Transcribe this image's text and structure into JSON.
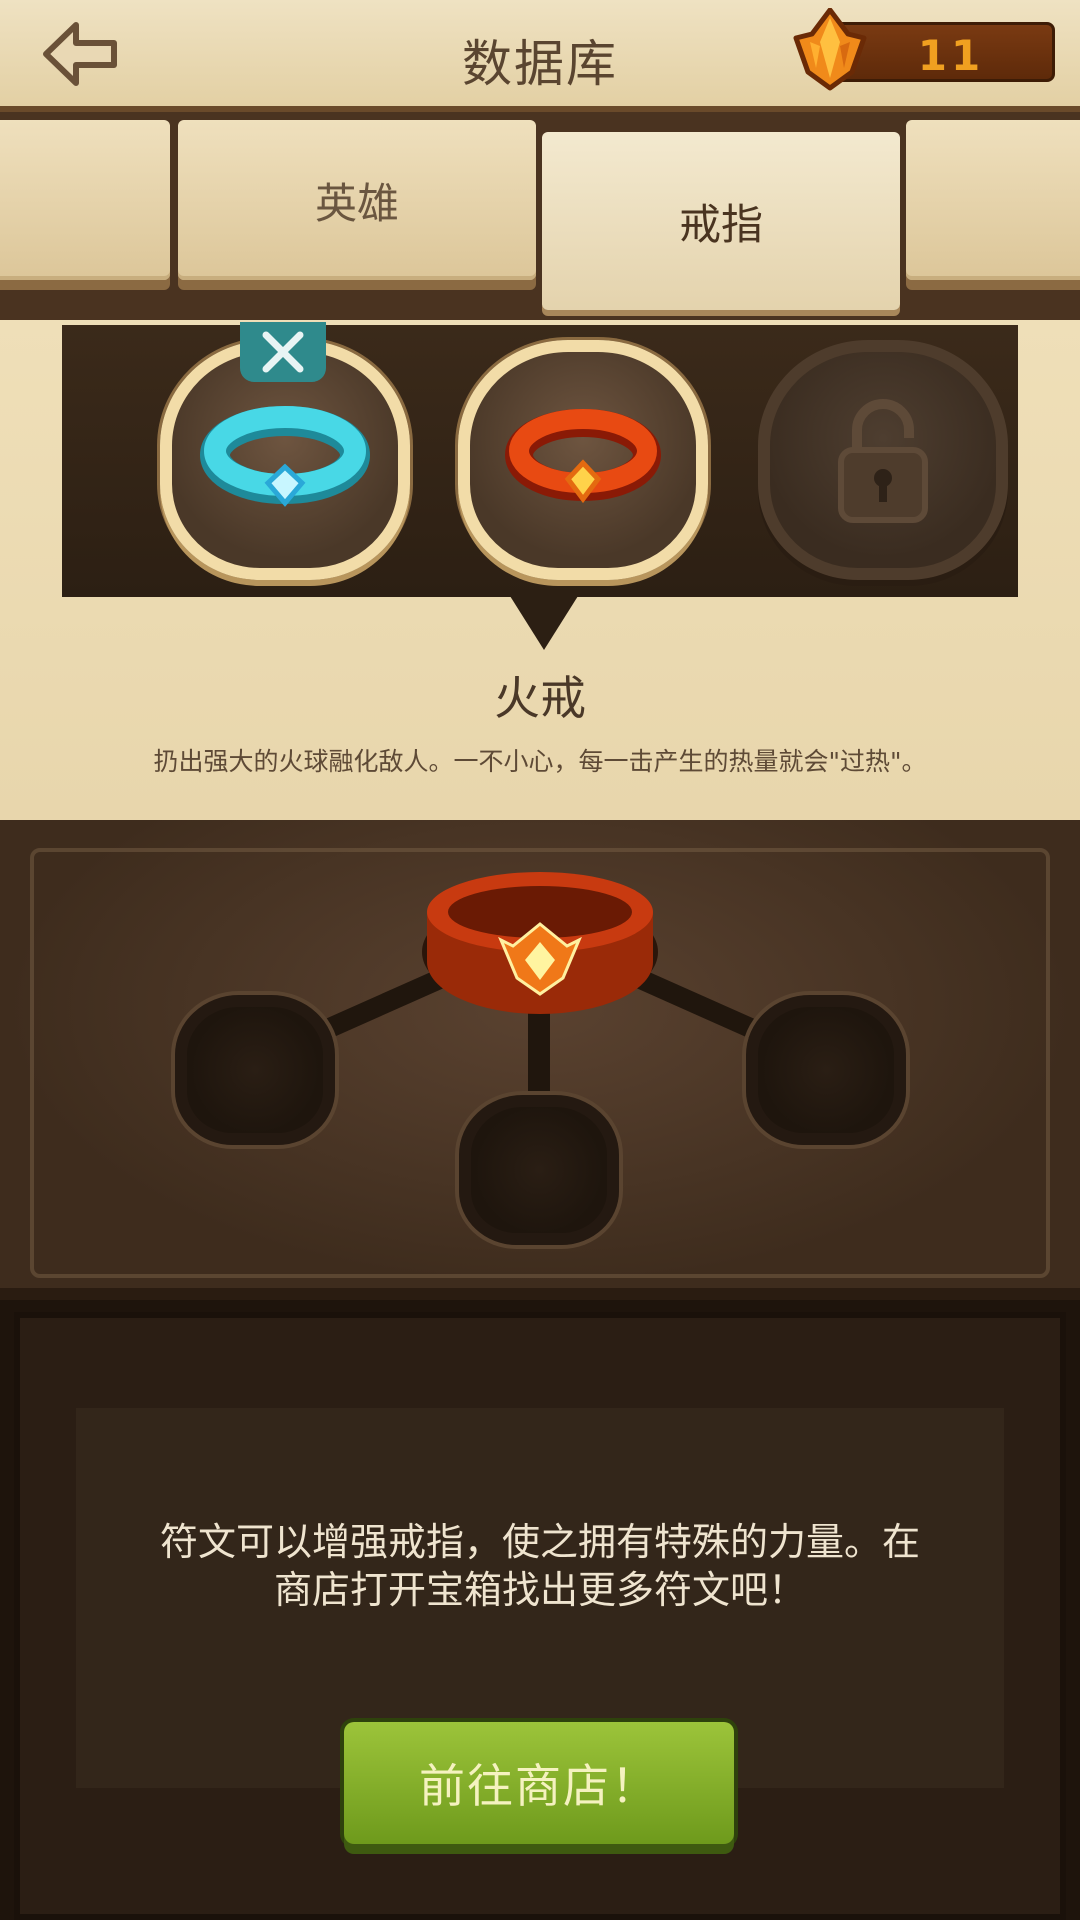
{
  "header": {
    "title": "数据库",
    "currency_value": "11"
  },
  "tabs": [
    {
      "label": ""
    },
    {
      "label": "英雄"
    },
    {
      "label": "戒指"
    },
    {
      "label": ""
    }
  ],
  "rings": [
    {
      "name": "ice-ring",
      "state": "equipped",
      "color": "#3ac8d8"
    },
    {
      "name": "fire-ring",
      "state": "selected",
      "color": "#e04010"
    },
    {
      "name": "locked-ring",
      "state": "locked"
    }
  ],
  "selected_ring": {
    "name": "火戒",
    "description": "扔出强大的火球融化敌人。一不小心，每一击产生的热量就会\"过热\"。"
  },
  "runes": {
    "info_text": "符文可以增强戒指，使之拥有特殊的力量。在商店打开宝箱找出更多符文吧！",
    "shop_button": "前往商店！"
  },
  "colors": {
    "parchment": "#efdfb8",
    "shop_green": "#8ab52c",
    "currency_orange": "#f0a020"
  }
}
